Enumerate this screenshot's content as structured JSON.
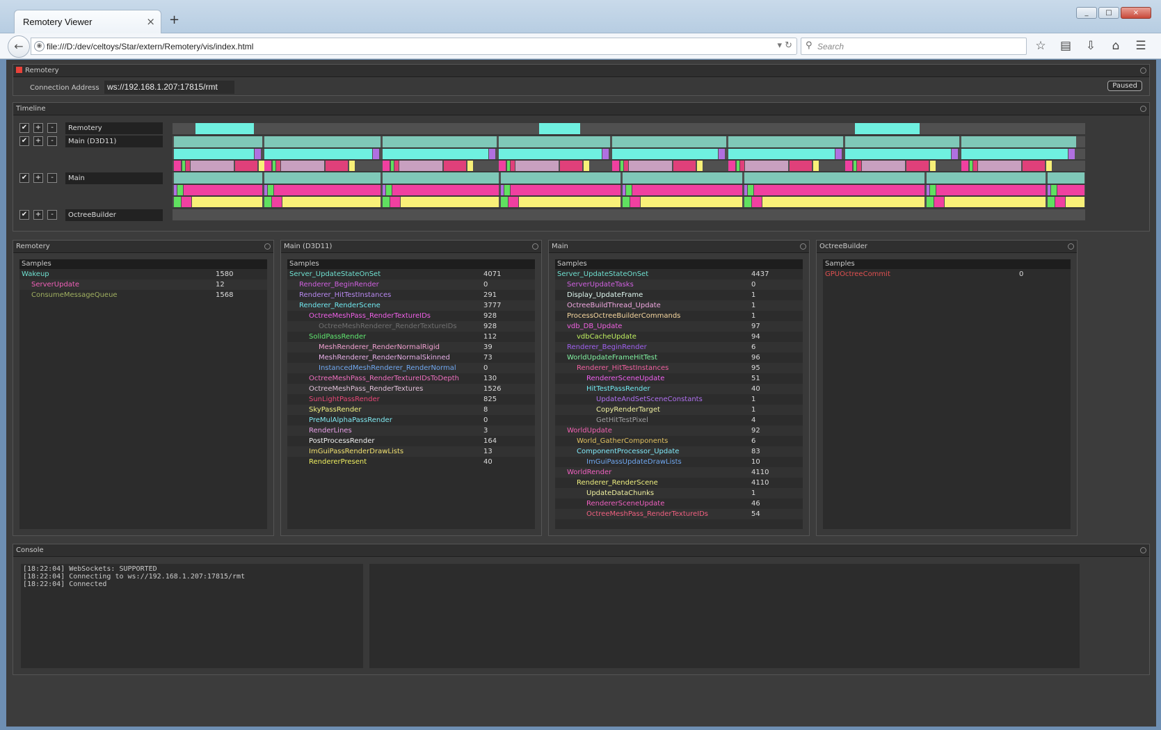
{
  "browser": {
    "tab_title": "Remotery Viewer",
    "tab_close": "×",
    "new_tab": "+",
    "url": "file:///D:/dev/celtoys/Star/extern/Remotery/vis/index.html",
    "search_placeholder": "Search",
    "window_buttons": [
      "_",
      "□",
      "×"
    ]
  },
  "remotery": {
    "title": "Remotery",
    "conn_label": "Connection Address",
    "conn_value": "ws://192.168.1.207:17815/rmt",
    "status_button": "Paused"
  },
  "timeline": {
    "title": "Timeline",
    "threads": [
      {
        "name": "Remotery",
        "check": "✔",
        "plus": "+",
        "minus": "-"
      },
      {
        "name": "Main (D3D11)",
        "check": "✔",
        "plus": "+",
        "minus": "-"
      },
      {
        "name": "Main",
        "check": "✔",
        "plus": "+",
        "minus": "-"
      },
      {
        "name": "OctreeBuilder",
        "check": "✔",
        "plus": "+",
        "minus": "-"
      }
    ]
  },
  "panels": [
    {
      "title": "Remotery",
      "header": "Samples",
      "rows": [
        {
          "name": "Wakeup",
          "value": "1580",
          "depth": 0,
          "color": "#6fe0d0"
        },
        {
          "name": "ServerUpdate",
          "value": "12",
          "depth": 1,
          "color": "#f060b8"
        },
        {
          "name": "ConsumeMessageQueue",
          "value": "1568",
          "depth": 1,
          "color": "#a0b060"
        }
      ]
    },
    {
      "title": "Main (D3D11)",
      "header": "Samples",
      "rows": [
        {
          "name": "Server_UpdateStateOnSet",
          "value": "4071",
          "depth": 0,
          "color": "#6fe0d0"
        },
        {
          "name": "Renderer_BeginRender",
          "value": "0",
          "depth": 1,
          "color": "#d060e0"
        },
        {
          "name": "Renderer_HitTestInstances",
          "value": "291",
          "depth": 1,
          "color": "#b888f0"
        },
        {
          "name": "Renderer_RenderScene",
          "value": "3777",
          "depth": 1,
          "color": "#70e8f0"
        },
        {
          "name": "OctreeMeshPass_RenderTextureIDs",
          "value": "928",
          "depth": 2,
          "color": "#f060e8"
        },
        {
          "name": "OctreeMeshRenderer_RenderTextureIDs",
          "value": "928",
          "depth": 3,
          "color": "#707070"
        },
        {
          "name": "SolidPassRender",
          "value": "112",
          "depth": 2,
          "color": "#60e870"
        },
        {
          "name": "MeshRenderer_RenderNormalRigid",
          "value": "39",
          "depth": 3,
          "color": "#f0a0d0"
        },
        {
          "name": "MeshRenderer_RenderNormalSkinned",
          "value": "73",
          "depth": 3,
          "color": "#e8b0e8"
        },
        {
          "name": "InstancedMeshRenderer_RenderNormal",
          "value": "0",
          "depth": 3,
          "color": "#70a8f0"
        },
        {
          "name": "OctreeMeshPass_RenderTextureIDsToDepth",
          "value": "130",
          "depth": 2,
          "color": "#f070c0"
        },
        {
          "name": "OctreeMeshPass_RenderTextures",
          "value": "1526",
          "depth": 2,
          "color": "#e0c0d8"
        },
        {
          "name": "SunLightPassRender",
          "value": "825",
          "depth": 2,
          "color": "#e84878"
        },
        {
          "name": "SkyPassRender",
          "value": "8",
          "depth": 2,
          "color": "#f0f080"
        },
        {
          "name": "PreMulAlphaPassRender",
          "value": "0",
          "depth": 2,
          "color": "#80e8f0"
        },
        {
          "name": "RenderLines",
          "value": "3",
          "depth": 2,
          "color": "#e8a0e8"
        },
        {
          "name": "PostProcessRender",
          "value": "164",
          "depth": 2,
          "color": "#f0f0f0"
        },
        {
          "name": "ImGuiPassRenderDrawLists",
          "value": "13",
          "depth": 2,
          "color": "#f0e070"
        },
        {
          "name": "RendererPresent",
          "value": "40",
          "depth": 2,
          "color": "#f0f060"
        }
      ]
    },
    {
      "title": "Main",
      "header": "Samples",
      "rows": [
        {
          "name": "Server_UpdateStateOnSet",
          "value": "4437",
          "depth": 0,
          "color": "#6fe0d0"
        },
        {
          "name": "ServerUpdateTasks",
          "value": "0",
          "depth": 1,
          "color": "#d060e0"
        },
        {
          "name": "Display_UpdateFrame",
          "value": "1",
          "depth": 1,
          "color": "#e0f8f0"
        },
        {
          "name": "OctreeBuildThread_Update",
          "value": "1",
          "depth": 1,
          "color": "#f0a8e0"
        },
        {
          "name": "ProcessOctreeBuilderCommands",
          "value": "1",
          "depth": 1,
          "color": "#f8d8a0"
        },
        {
          "name": "vdb_DB_Update",
          "value": "97",
          "depth": 1,
          "color": "#f060e0"
        },
        {
          "name": "vdbCacheUpdate",
          "value": "94",
          "depth": 2,
          "color": "#c0f060"
        },
        {
          "name": "Renderer_BeginRender",
          "value": "6",
          "depth": 1,
          "color": "#a060f0"
        },
        {
          "name": "WorldUpdateFrameHitTest",
          "value": "96",
          "depth": 1,
          "color": "#80f0a0"
        },
        {
          "name": "Renderer_HitTestInstances",
          "value": "95",
          "depth": 2,
          "color": "#f060a0"
        },
        {
          "name": "RendererSceneUpdate",
          "value": "51",
          "depth": 3,
          "color": "#f060f0"
        },
        {
          "name": "HitTestPassRender",
          "value": "40",
          "depth": 3,
          "color": "#70e8f0"
        },
        {
          "name": "UpdateAndSetSceneConstants",
          "value": "1",
          "depth": 4,
          "color": "#b070f0"
        },
        {
          "name": "CopyRenderTarget",
          "value": "1",
          "depth": 4,
          "color": "#f0f0a0"
        },
        {
          "name": "GetHitTestPixel",
          "value": "4",
          "depth": 4,
          "color": "#a0a0a0"
        },
        {
          "name": "WorldUpdate",
          "value": "92",
          "depth": 1,
          "color": "#f060b0"
        },
        {
          "name": "World_GatherComponents",
          "value": "6",
          "depth": 2,
          "color": "#e0c060"
        },
        {
          "name": "ComponentProcessor_Update",
          "value": "83",
          "depth": 2,
          "color": "#80e8f8"
        },
        {
          "name": "ImGuiPassUpdateDrawLists",
          "value": "10",
          "depth": 3,
          "color": "#70a8f0"
        },
        {
          "name": "WorldRender",
          "value": "4110",
          "depth": 1,
          "color": "#f060c0"
        },
        {
          "name": "Renderer_RenderScene",
          "value": "4110",
          "depth": 2,
          "color": "#f0f080"
        },
        {
          "name": "UpdateDataChunks",
          "value": "1",
          "depth": 3,
          "color": "#f0f0a0"
        },
        {
          "name": "RendererSceneUpdate",
          "value": "46",
          "depth": 3,
          "color": "#f060c0"
        },
        {
          "name": "OctreeMeshPass_RenderTextureIDs",
          "value": "54",
          "depth": 3,
          "color": "#f06080"
        }
      ]
    },
    {
      "title": "OctreeBuilder",
      "header": "Samples",
      "rows": [
        {
          "name": "GPUOctreeCommit",
          "value": "0",
          "depth": 0,
          "color": "#e05050"
        }
      ]
    }
  ],
  "console": {
    "title": "Console",
    "lines": [
      "[18:22:04] WebSockets: SUPPORTED",
      "[18:22:04] Connecting to ws://192.168.1.207:17815/rmt",
      "[18:22:04] Connected"
    ]
  },
  "colors": {
    "cyan": "#6ff0e0",
    "teal": "#7fc8b8",
    "pink": "#f040a0",
    "yellow": "#f8f078",
    "purple": "#b070e0",
    "green": "#60e060",
    "lightpink": "#c8a0c0",
    "rose": "#e0407a"
  }
}
